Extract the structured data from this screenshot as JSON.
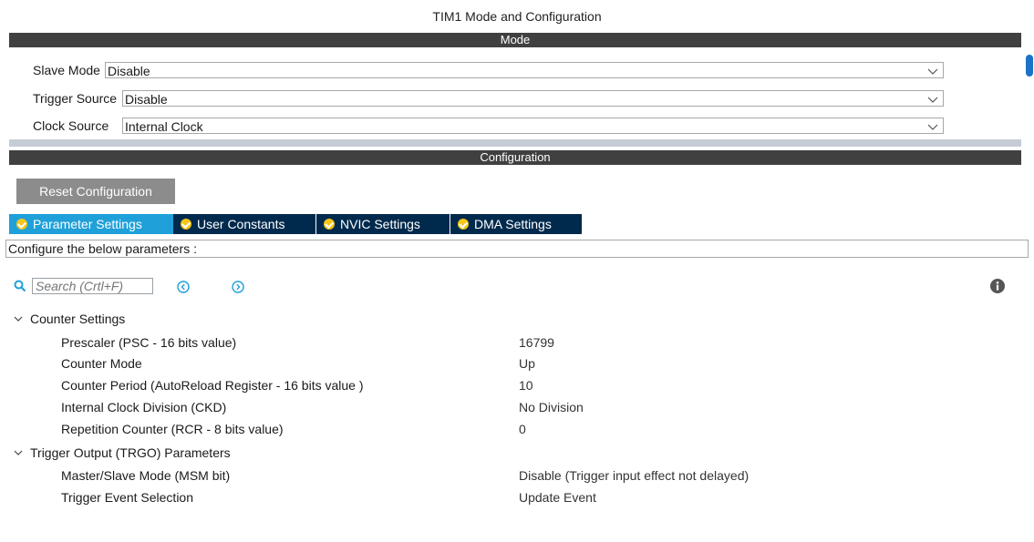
{
  "window": {
    "title": "TIM1 Mode and Configuration"
  },
  "mode_section": {
    "header": "Mode",
    "rows": [
      {
        "label": "Slave Mode",
        "value": "Disable"
      },
      {
        "label": "Trigger Source",
        "value": "Disable"
      },
      {
        "label": "Clock Source",
        "value": "Internal Clock"
      }
    ]
  },
  "config_section": {
    "header": "Configuration",
    "reset_label": "Reset Configuration",
    "tabs": [
      {
        "label": "Parameter Settings",
        "active": true
      },
      {
        "label": "User Constants",
        "active": false
      },
      {
        "label": "NVIC Settings",
        "active": false
      },
      {
        "label": "DMA Settings",
        "active": false
      }
    ],
    "configure_text": "Configure the below parameters :",
    "search": {
      "placeholder": "Search (Crtl+F)"
    }
  },
  "parameters": {
    "groups": [
      {
        "title": "Counter Settings",
        "items": [
          {
            "label": "Prescaler (PSC - 16 bits value)",
            "value": "16799"
          },
          {
            "label": "Counter Mode",
            "value": "Up"
          },
          {
            "label": "Counter Period (AutoReload Register - 16 bits value )",
            "value": "10"
          },
          {
            "label": "Internal Clock Division (CKD)",
            "value": "No Division"
          },
          {
            "label": "Repetition Counter (RCR - 8 bits value)",
            "value": "0"
          }
        ]
      },
      {
        "title": "Trigger Output (TRGO) Parameters",
        "items": [
          {
            "label": "Master/Slave Mode (MSM bit)",
            "value": "Disable (Trigger input effect not delayed)"
          },
          {
            "label": "Trigger Event Selection",
            "value": "Update Event"
          }
        ]
      }
    ]
  },
  "colors": {
    "section_header_bg": "#404040",
    "tab_active": "#1fa0d9",
    "tab_inactive": "#002a4d",
    "check_icon": "#f5c518",
    "accent_icon": "#1fa0d9",
    "scrollbar": "#1a73c6"
  }
}
